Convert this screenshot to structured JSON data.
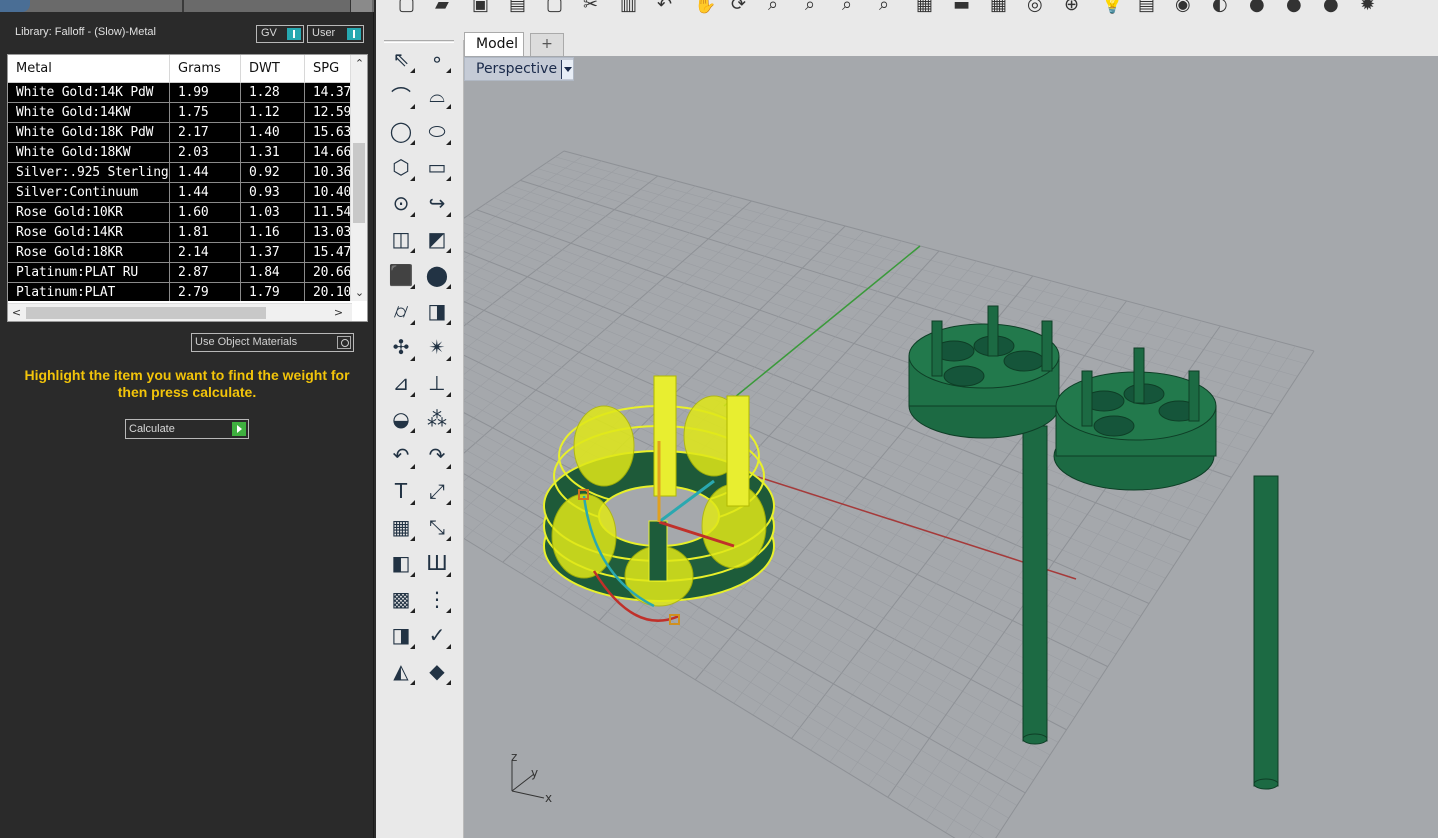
{
  "panel": {
    "library_title": "Library: Falloff - (Slow)-Metal",
    "toggle_gv": "GV",
    "toggle_user": "User",
    "use_object_materials": "Use Object Materials",
    "hint": "Highlight the item you want to find the weight for then press calculate.",
    "calculate": "Calculate",
    "table": {
      "headers": [
        "Metal",
        "Grams",
        "DWT",
        "SPG"
      ],
      "rows": [
        [
          "White Gold:14K PdW",
          "1.99",
          "1.28",
          "14.37"
        ],
        [
          "White Gold:14KW",
          "1.75",
          "1.12",
          "12.59"
        ],
        [
          "White Gold:18K PdW",
          "2.17",
          "1.40",
          "15.63"
        ],
        [
          "White Gold:18KW",
          "2.03",
          "1.31",
          "14.66"
        ],
        [
          "Silver:.925 Sterling",
          "1.44",
          "0.92",
          "10.36"
        ],
        [
          "Silver:Continuum",
          "1.44",
          "0.93",
          "10.40"
        ],
        [
          "Rose Gold:10KR",
          "1.60",
          "1.03",
          "11.54"
        ],
        [
          "Rose Gold:14KR",
          "1.81",
          "1.16",
          "13.03"
        ],
        [
          "Rose Gold:18KR",
          "2.14",
          "1.37",
          "15.47"
        ],
        [
          "Platinum:PLAT RU",
          "2.87",
          "1.84",
          "20.66"
        ],
        [
          "Platinum:PLAT",
          "2.79",
          "1.79",
          "20.10"
        ]
      ]
    }
  },
  "tabs": {
    "model": "Model",
    "add": "+"
  },
  "viewport": {
    "label": "Perspective"
  },
  "axis_icon": {
    "z": "z",
    "y": "y",
    "x": "x"
  },
  "colors": {
    "selection_yellow": "#f0f020",
    "object_green": "#1a6e44",
    "hint_yellow": "#f2c40a",
    "viewport_bg": "#a5a8ac"
  },
  "left_tools": [
    "select-arrow-icon",
    "point-icon",
    "polyline-icon",
    "curve-icon",
    "circle-icon",
    "ellipse-icon",
    "polygon-icon",
    "rectangle-icon",
    "arc-icon",
    "fillet-icon",
    "surface-icon",
    "loft-icon",
    "box-icon",
    "sphere-icon",
    "cylinder-icon",
    "mesh-icon",
    "transform-icon",
    "explode-icon",
    "trim-icon",
    "split-icon",
    "boolean-icon",
    "group-icon",
    "offset-icon",
    "blend-icon",
    "text-icon",
    "scale-icon",
    "array-icon",
    "orient-icon",
    "extrude-icon",
    "dimension-icon",
    "grid-array-icon",
    "align-icon",
    "flow-icon",
    "check-icon",
    "render-icon",
    "light-icon"
  ],
  "top_tools": [
    "new-file-icon",
    "open-file-icon",
    "save-icon",
    "print-icon",
    "copy-icon",
    "cut-icon",
    "paste-icon",
    "undo-icon",
    "pan-icon",
    "rotate-view-icon",
    "zoom-icon",
    "zoom-window-icon",
    "zoom-extents-icon",
    "zoom-selected-icon",
    "layout-icon",
    "car-icon",
    "grid-icon",
    "snap-icon",
    "osnap-icon",
    "light-icon",
    "layer-icon",
    "render-icon",
    "color-wheel-icon",
    "material-icon",
    "sphere-icon",
    "globe-icon",
    "settings-icon"
  ]
}
